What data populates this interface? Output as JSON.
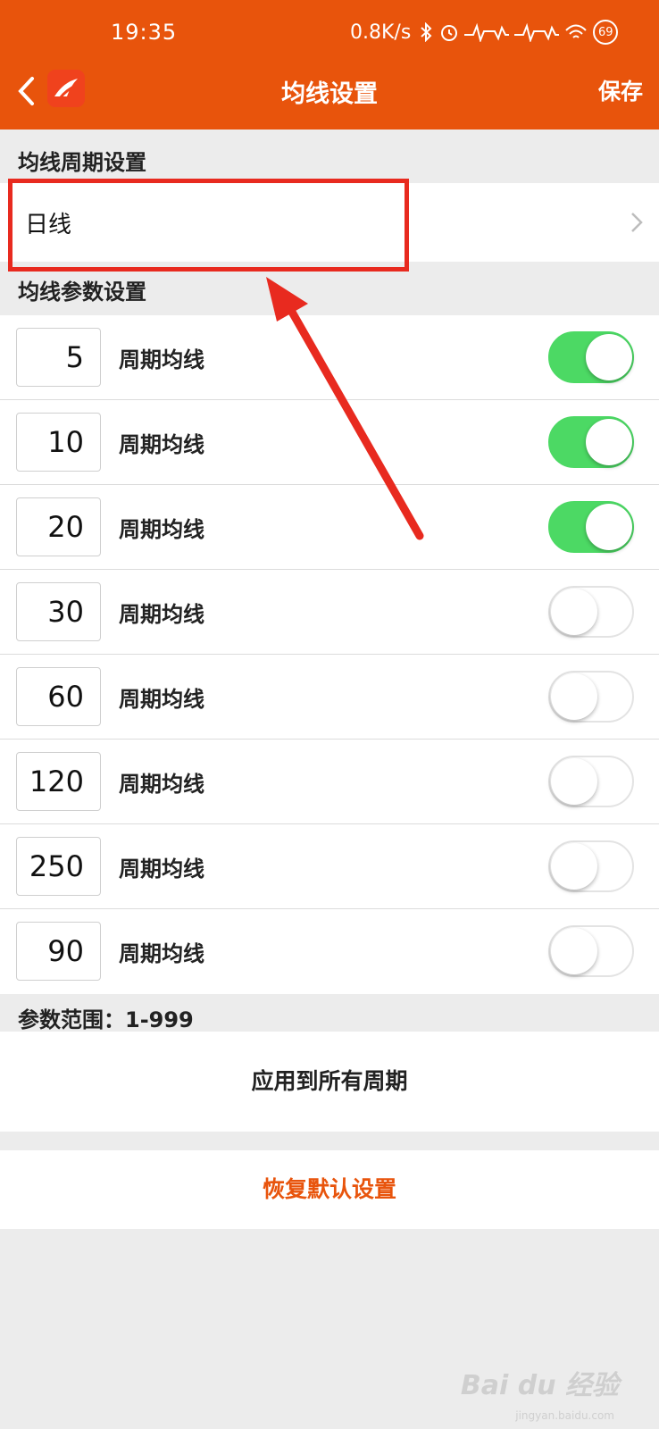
{
  "status_bar": {
    "time": "19:35",
    "speed": "0.8K/s",
    "battery": "69"
  },
  "header": {
    "title": "均线设置",
    "save_label": "保存",
    "back_icon": "chevron-left-icon",
    "logo_icon": "app-logo-icon"
  },
  "period_section": {
    "label": "均线周期设置",
    "selected_period": "日线"
  },
  "param_section": {
    "label": "均线参数设置",
    "rows": [
      {
        "value": "5",
        "label": "周期均线",
        "enabled": true
      },
      {
        "value": "10",
        "label": "周期均线",
        "enabled": true
      },
      {
        "value": "20",
        "label": "周期均线",
        "enabled": true
      },
      {
        "value": "30",
        "label": "周期均线",
        "enabled": false
      },
      {
        "value": "60",
        "label": "周期均线",
        "enabled": false
      },
      {
        "value": "120",
        "label": "周期均线",
        "enabled": false
      },
      {
        "value": "250",
        "label": "周期均线",
        "enabled": false
      },
      {
        "value": "90",
        "label": "周期均线",
        "enabled": false
      }
    ]
  },
  "range_note": "参数范围：1-999",
  "apply_all_label": "应用到所有周期",
  "restore_default_label": "恢复默认设置",
  "watermark": {
    "text": "Bai du 经验",
    "url": "jingyan.baidu.com"
  },
  "colors": {
    "brand": "#e8540c",
    "toggle_on": "#4cd964",
    "highlight": "#e82a1f"
  }
}
